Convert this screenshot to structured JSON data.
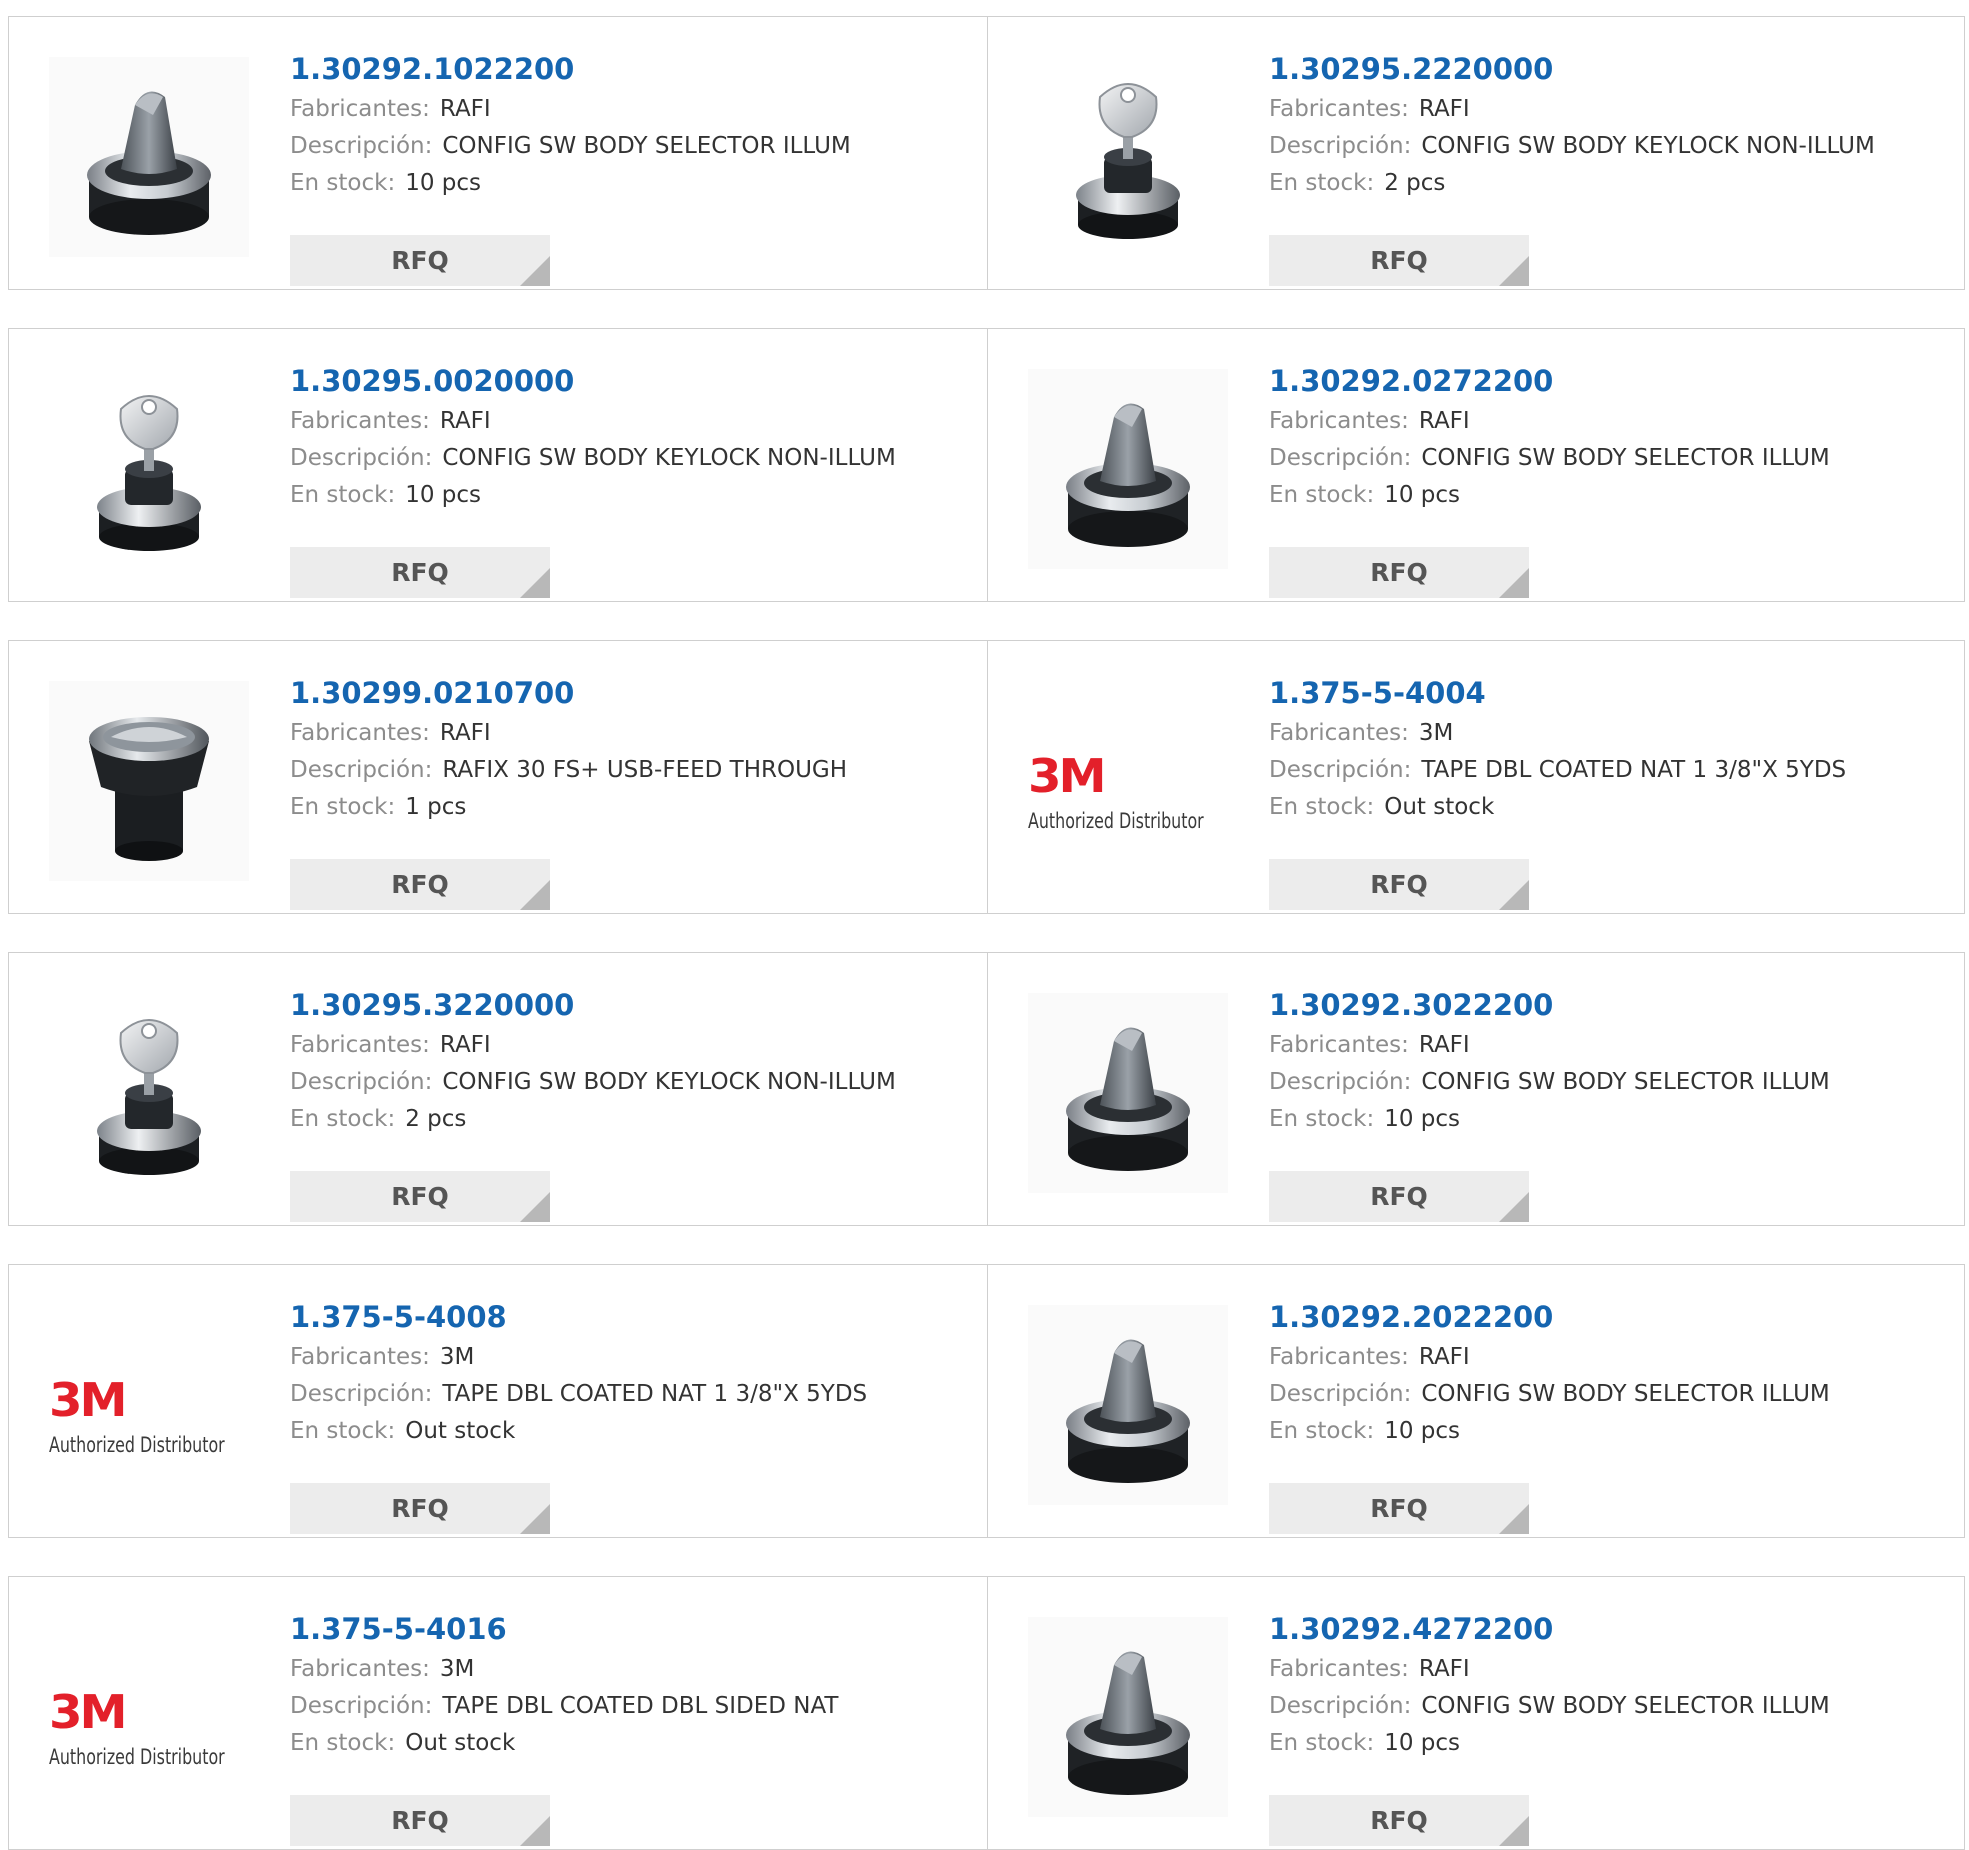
{
  "labels": {
    "manufacturer": "Fabricantes:",
    "description": "Descripción:",
    "stock": "En stock:",
    "rfq_button": "RFQ",
    "logo_brand": "3M",
    "logo_tagline": "Authorized Distributor"
  },
  "colors": {
    "part_number_link": "#1565b0",
    "label_gray": "#8c8c8c",
    "rfq_background": "#ececec",
    "brand_3m_red": "#e3202a",
    "border": "#cfcfcf"
  },
  "products": [
    {
      "part_number": "1.30292.1022200",
      "manufacturer": "RAFI",
      "description": "CONFIG SW BODY SELECTOR ILLUM",
      "stock": "10 pcs",
      "image": "selector-switch-image"
    },
    {
      "part_number": "1.30295.2220000",
      "manufacturer": "RAFI",
      "description": "CONFIG SW BODY KEYLOCK NON-ILLUM",
      "stock": "2 pcs",
      "image": "keylock-switch-image"
    },
    {
      "part_number": "1.30295.0020000",
      "manufacturer": "RAFI",
      "description": "CONFIG SW BODY KEYLOCK NON-ILLUM",
      "stock": "10 pcs",
      "image": "keylock-switch-image"
    },
    {
      "part_number": "1.30292.0272200",
      "manufacturer": "RAFI",
      "description": "CONFIG SW BODY SELECTOR ILLUM",
      "stock": "10 pcs",
      "image": "selector-switch-image"
    },
    {
      "part_number": "1.30299.0210700",
      "manufacturer": "RAFI",
      "description": "RAFIX 30 FS+ USB-FEED THROUGH",
      "stock": "1 pcs",
      "image": "usb-feedthrough-image"
    },
    {
      "part_number": "1.375-5-4004",
      "manufacturer": "3M",
      "description": "TAPE DBL COATED NAT 1 3/8\"X 5YDS",
      "stock": "Out stock",
      "image": "3m-authorized-distributor-logo"
    },
    {
      "part_number": "1.30295.3220000",
      "manufacturer": "RAFI",
      "description": "CONFIG SW BODY KEYLOCK NON-ILLUM",
      "stock": "2 pcs",
      "image": "keylock-switch-image"
    },
    {
      "part_number": "1.30292.3022200",
      "manufacturer": "RAFI",
      "description": "CONFIG SW BODY SELECTOR ILLUM",
      "stock": "10 pcs",
      "image": "selector-switch-image"
    },
    {
      "part_number": "1.375-5-4008",
      "manufacturer": "3M",
      "description": "TAPE DBL COATED NAT 1 3/8\"X 5YDS",
      "stock": "Out stock",
      "image": "3m-authorized-distributor-logo"
    },
    {
      "part_number": "1.30292.2022200",
      "manufacturer": "RAFI",
      "description": "CONFIG SW BODY SELECTOR ILLUM",
      "stock": "10 pcs",
      "image": "selector-switch-image"
    },
    {
      "part_number": "1.375-5-4016",
      "manufacturer": "3M",
      "description": "TAPE DBL COATED DBL SIDED NAT",
      "stock": "Out stock",
      "image": "3m-authorized-distributor-logo"
    },
    {
      "part_number": "1.30292.4272200",
      "manufacturer": "RAFI",
      "description": "CONFIG SW BODY SELECTOR ILLUM",
      "stock": "10 pcs",
      "image": "selector-switch-image"
    }
  ]
}
